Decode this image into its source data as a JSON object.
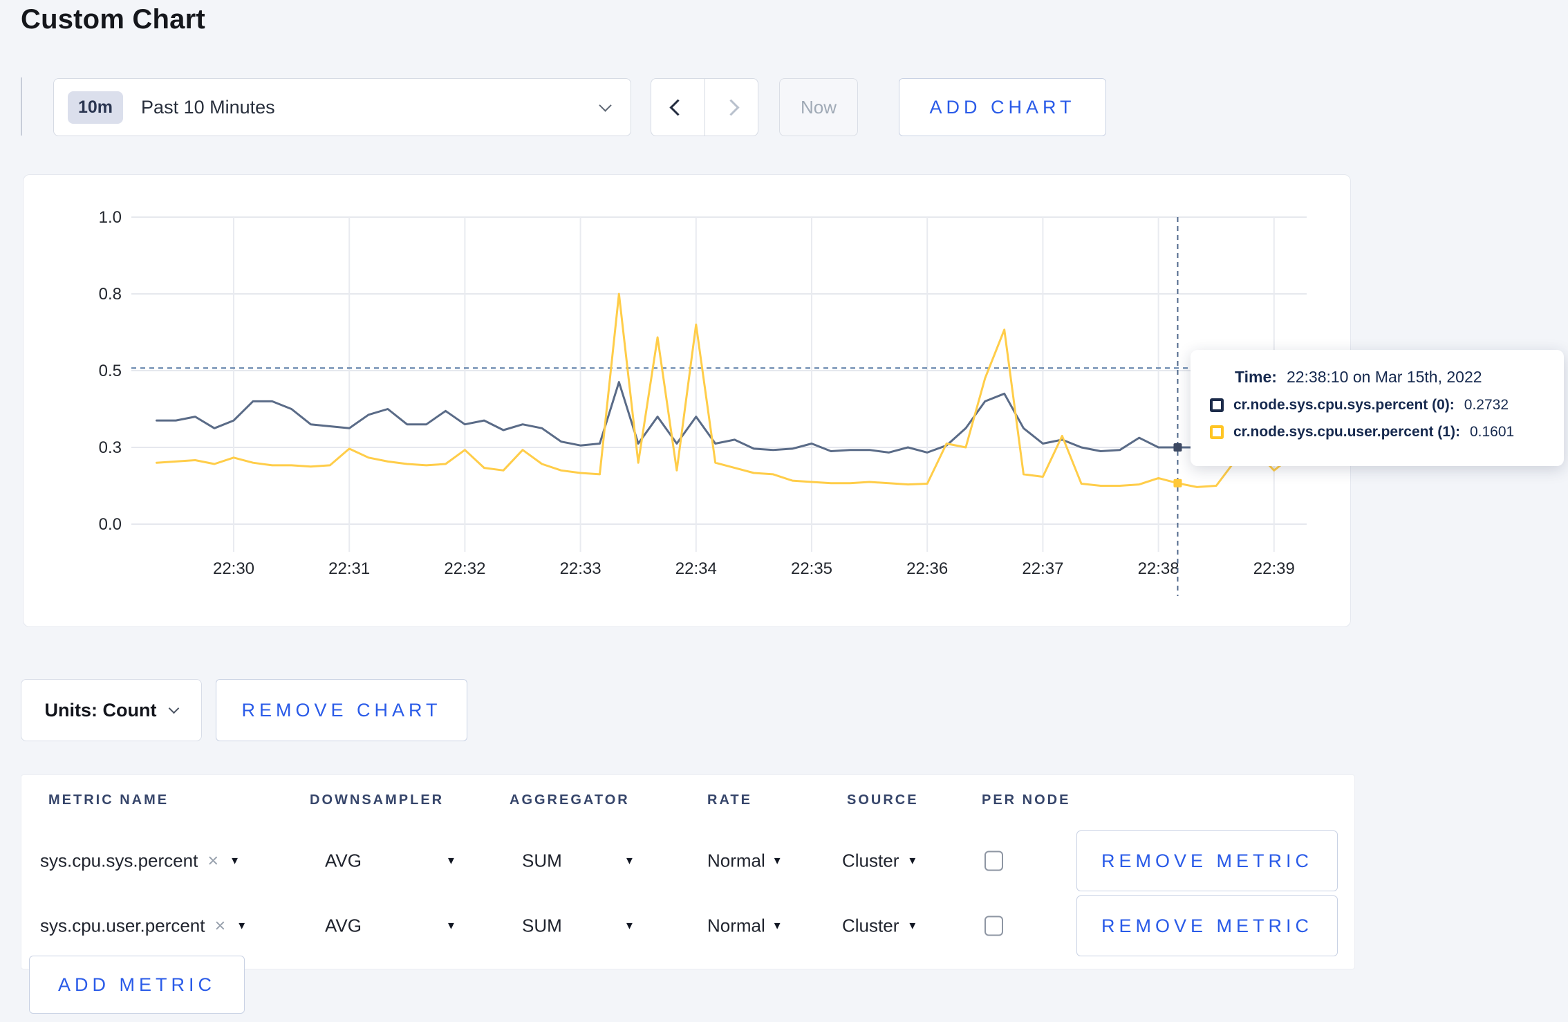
{
  "page": {
    "title": "Custom Chart"
  },
  "toolbar": {
    "time_selector": {
      "badge": "10m",
      "label": "Past 10 Minutes"
    },
    "now_button": "Now",
    "add_chart_button": "ADD CHART"
  },
  "chart_controls": {
    "units_button": "Units: Count",
    "remove_chart_button": "REMOVE CHART"
  },
  "tooltip": {
    "time_label": "Time:",
    "time_value": "22:38:10 on Mar 15th, 2022",
    "rows": [
      {
        "name": "cr.node.sys.cpu.sys.percent (0):",
        "value": "0.2732",
        "color": "#1C2B4A"
      },
      {
        "name": "cr.node.sys.cpu.user.percent (1):",
        "value": "0.1601",
        "color": "#FFC524"
      }
    ]
  },
  "metrics_table": {
    "headers": [
      "METRIC NAME",
      "DOWNSAMPLER",
      "AGGREGATOR",
      "RATE",
      "SOURCE",
      "PER NODE"
    ],
    "rows": [
      {
        "metric": "sys.cpu.sys.percent",
        "remove_icon": "×",
        "downsampler": "AVG",
        "aggregator": "SUM",
        "rate": "Normal",
        "source": "Cluster",
        "per_node_checked": false,
        "remove_button": "REMOVE METRIC"
      },
      {
        "metric": "sys.cpu.user.percent",
        "remove_icon": "×",
        "downsampler": "AVG",
        "aggregator": "SUM",
        "rate": "Normal",
        "source": "Cluster",
        "per_node_checked": false,
        "remove_button": "REMOVE METRIC"
      }
    ],
    "add_metric_button": "ADD METRIC"
  },
  "chart_data": {
    "type": "line",
    "title": "",
    "xlabel": "",
    "ylabel": "",
    "grid": true,
    "legend_position": "tooltip",
    "x_axis": {
      "tick_labels": [
        "22:30",
        "22:31",
        "22:32",
        "22:33",
        "22:34",
        "22:35",
        "22:36",
        "22:37",
        "22:38",
        "22:39"
      ],
      "tick_seconds": [
        0,
        60,
        120,
        180,
        240,
        300,
        360,
        420,
        480,
        540
      ]
    },
    "y_axis": {
      "ticks": [
        0,
        0.3,
        0.5,
        0.8,
        1.0
      ],
      "tick_labels": [
        "0.0",
        "0.3",
        "0.5",
        "0.8",
        "1.0"
      ],
      "range": [
        0,
        1
      ]
    },
    "x_start_time": "22:29:20",
    "x_start_sec": -40,
    "x_step_sec": 10,
    "series": [
      {
        "name": "cr.node.sys.cpu.sys.percent",
        "color": "#5A6B87",
        "marker_color": "#3E4A63",
        "values": [
          0.37,
          0.37,
          0.38,
          0.35,
          0.37,
          0.42,
          0.42,
          0.4,
          0.36,
          0.355,
          0.35,
          0.385,
          0.4,
          0.36,
          0.36,
          0.395,
          0.36,
          0.37,
          0.345,
          0.36,
          0.35,
          0.315,
          0.305,
          0.31,
          0.47,
          0.31,
          0.38,
          0.31,
          0.38,
          0.31,
          0.32,
          0.295,
          0.29,
          0.295,
          0.31,
          0.285,
          0.29,
          0.29,
          0.28,
          0.3,
          0.28,
          0.305,
          0.35,
          0.42,
          0.44,
          0.35,
          0.31,
          0.32,
          0.3,
          0.285,
          0.29,
          0.325,
          0.3,
          0.3,
          0.3,
          0.31,
          0.3,
          0.295,
          0.3,
          0.31
        ]
      },
      {
        "name": "cr.node.sys.cpu.user.percent",
        "color": "#FFCD49",
        "marker_color": "#FFC838",
        "values": [
          0.24,
          0.245,
          0.25,
          0.235,
          0.26,
          0.24,
          0.23,
          0.23,
          0.225,
          0.23,
          0.295,
          0.26,
          0.245,
          0.235,
          0.23,
          0.235,
          0.29,
          0.22,
          0.21,
          0.29,
          0.235,
          0.21,
          0.2,
          0.195,
          0.8,
          0.24,
          0.63,
          0.21,
          0.68,
          0.24,
          0.22,
          0.2,
          0.195,
          0.17,
          0.165,
          0.16,
          0.16,
          0.165,
          0.16,
          0.155,
          0.158,
          0.31,
          0.3,
          0.48,
          0.66,
          0.195,
          0.185,
          0.33,
          0.158,
          0.15,
          0.15,
          0.155,
          0.18,
          0.1601,
          0.145,
          0.15,
          0.25,
          0.29,
          0.21,
          0.27
        ]
      }
    ],
    "cursor": {
      "index": 53,
      "time": "22:38:10",
      "h_line_value": 0.51
    }
  }
}
